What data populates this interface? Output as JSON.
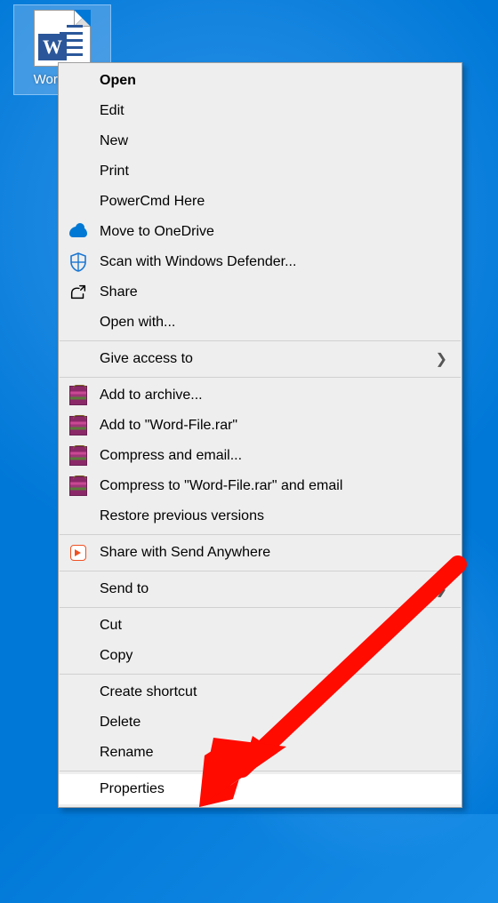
{
  "desktop": {
    "file_label": "Word-File",
    "file_type_badge": "W"
  },
  "context_menu": {
    "items": [
      {
        "id": "open",
        "label": "Open",
        "bold": true
      },
      {
        "id": "edit",
        "label": "Edit"
      },
      {
        "id": "new",
        "label": "New"
      },
      {
        "id": "print",
        "label": "Print"
      },
      {
        "id": "powercmd",
        "label": "PowerCmd Here"
      },
      {
        "id": "onedrive",
        "label": "Move to OneDrive",
        "icon": "onedrive"
      },
      {
        "id": "defender",
        "label": "Scan with Windows Defender...",
        "icon": "defender"
      },
      {
        "id": "share",
        "label": "Share",
        "icon": "share"
      },
      {
        "id": "openwith",
        "label": "Open with..."
      },
      {
        "sep": true
      },
      {
        "id": "giveaccess",
        "label": "Give access to",
        "submenu": true
      },
      {
        "sep": true
      },
      {
        "id": "addarchive",
        "label": "Add to archive...",
        "icon": "winrar"
      },
      {
        "id": "addtorar",
        "label": "Add to \"Word-File.rar\"",
        "icon": "winrar"
      },
      {
        "id": "compressmail",
        "label": "Compress and email...",
        "icon": "winrar"
      },
      {
        "id": "compresstorarmail",
        "label": "Compress to \"Word-File.rar\" and email",
        "icon": "winrar"
      },
      {
        "id": "restore",
        "label": "Restore previous versions"
      },
      {
        "sep": true
      },
      {
        "id": "sendanywhere",
        "label": "Share with Send Anywhere",
        "icon": "sendanywhere"
      },
      {
        "sep": true
      },
      {
        "id": "sendto",
        "label": "Send to",
        "submenu": true
      },
      {
        "sep": true
      },
      {
        "id": "cut",
        "label": "Cut"
      },
      {
        "id": "copy",
        "label": "Copy"
      },
      {
        "sep": true
      },
      {
        "id": "createshortcut",
        "label": "Create shortcut"
      },
      {
        "id": "delete",
        "label": "Delete"
      },
      {
        "id": "rename",
        "label": "Rename"
      },
      {
        "sep": true
      },
      {
        "id": "properties",
        "label": "Properties",
        "highlighted": true
      }
    ]
  },
  "annotation": {
    "arrow_color": "#ff0b00",
    "target": "properties"
  }
}
